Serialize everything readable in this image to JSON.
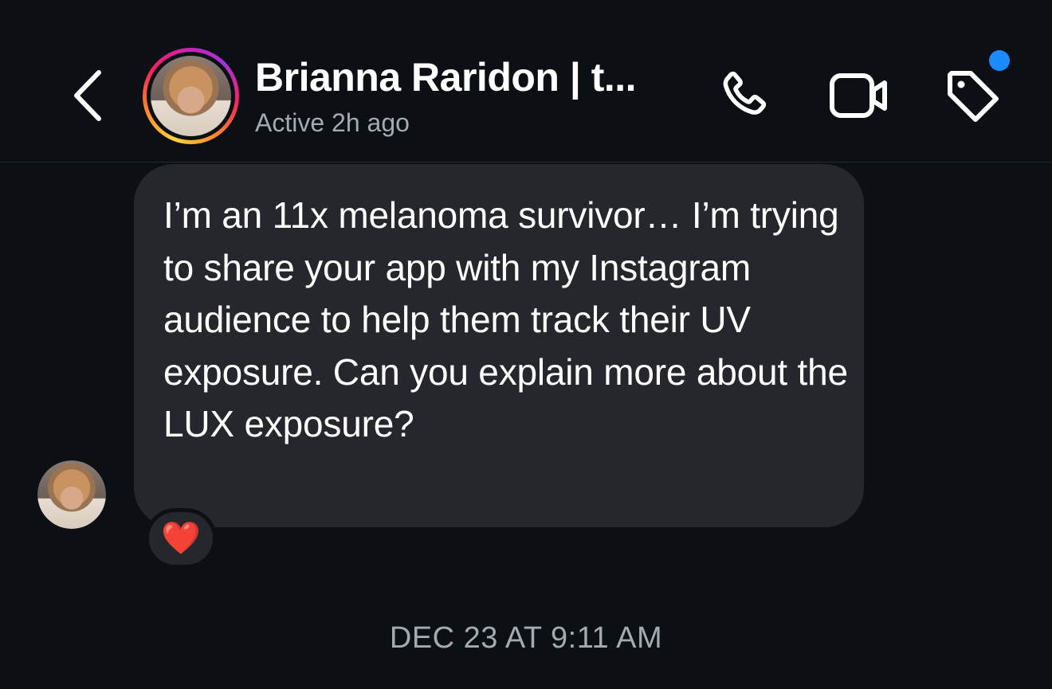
{
  "header": {
    "contact_name": "Brianna Raridon | t...",
    "status": "Active 2h ago",
    "icons": {
      "back": "chevron-left-icon",
      "call": "phone-icon",
      "video": "video-camera-icon",
      "tag": "tag-icon"
    },
    "notification_dot_color": "#1a8cff"
  },
  "conversation": {
    "message": {
      "text": "I’m an 11x melanoma survivor… I’m trying to share your app with my Instagram audience to help them track their UV exposure. Can you explain more about the LUX exposure?",
      "reaction": "❤️"
    },
    "timestamp": "DEC 23 AT 9:11 AM"
  },
  "colors": {
    "background": "#0c0f14",
    "bubble": "#25272d",
    "secondary_text": "#a5a9b0"
  }
}
